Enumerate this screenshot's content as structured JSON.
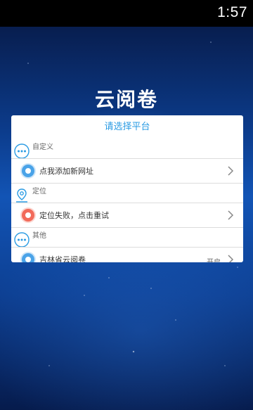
{
  "status_bar": {
    "time": "1:57"
  },
  "app": {
    "title": "云阅卷"
  },
  "dialog": {
    "title": "请选择平台",
    "sections": [
      {
        "label": "自定义",
        "icon": "more-dots-icon",
        "items": [
          {
            "label": "点我添加新网址",
            "dot_color": "#4aa3e8"
          }
        ]
      },
      {
        "label": "定位",
        "icon": "location-pin-icon",
        "items": [
          {
            "label": "定位失败，点击重试",
            "dot_color": "#f26a5a"
          }
        ]
      },
      {
        "label": "其他",
        "icon": "more-dots-icon",
        "items": [
          {
            "label": "吉林省云阅卷",
            "right_tag": "开启",
            "dot_color": "#4aa3e8"
          }
        ]
      }
    ]
  },
  "colors": {
    "accent": "#2a9be3",
    "icon_blue": "#4aa3e8",
    "icon_red": "#f26a5a"
  }
}
